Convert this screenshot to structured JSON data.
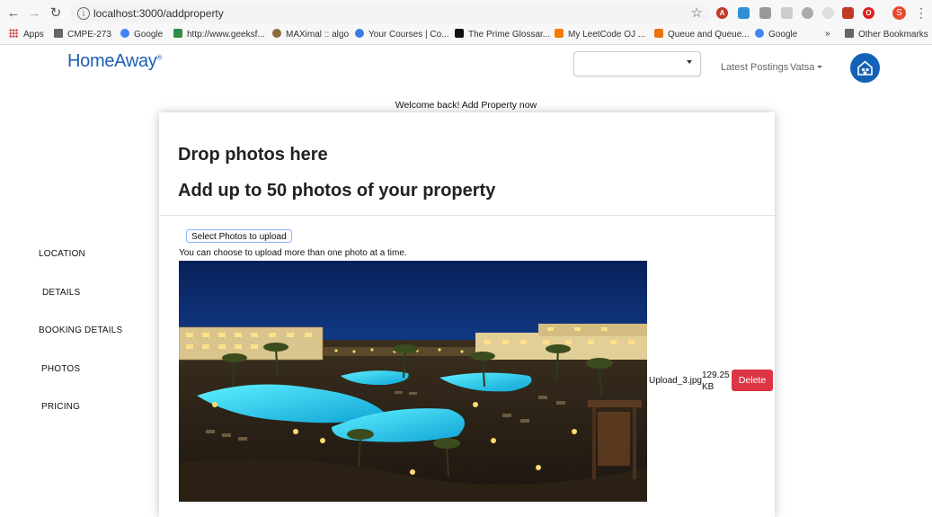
{
  "browser": {
    "url": "localhost:3000/addproperty",
    "profile_initial": "S",
    "bookmarks": [
      "Apps",
      "CMPE-273",
      "Google",
      "http://www.geeksf...",
      "MAXimal :: algo",
      "Your Courses | Co...",
      "The Prime Glossar...",
      "My LeetCode OJ ...",
      "Queue and Queue...",
      "Google",
      "»",
      "Other Bookmarks"
    ]
  },
  "header": {
    "logo": "HomeAway",
    "logo_mark": "®",
    "select_value": "",
    "nav": {
      "latest": "Latest Postings",
      "user": "Vatsa"
    }
  },
  "welcome": "Welcome back! Add Property now",
  "sidebar": {
    "items": [
      "LOCATION",
      "DETAILS",
      "BOOKING DETAILS",
      "PHOTOS",
      "PRICING"
    ]
  },
  "card": {
    "title1": "Drop photos here",
    "title2": "Add up to 50 photos of your property",
    "upload_button": "Select Photos to upload",
    "hint": "You can choose to upload more than one photo at a time.",
    "file": {
      "name": "Upload_3.jpg",
      "size_value": "129.25",
      "size_unit": "KB",
      "delete": "Delete"
    }
  },
  "colors": {
    "brand": "#1e5fb4",
    "delete": "#dc3545"
  }
}
